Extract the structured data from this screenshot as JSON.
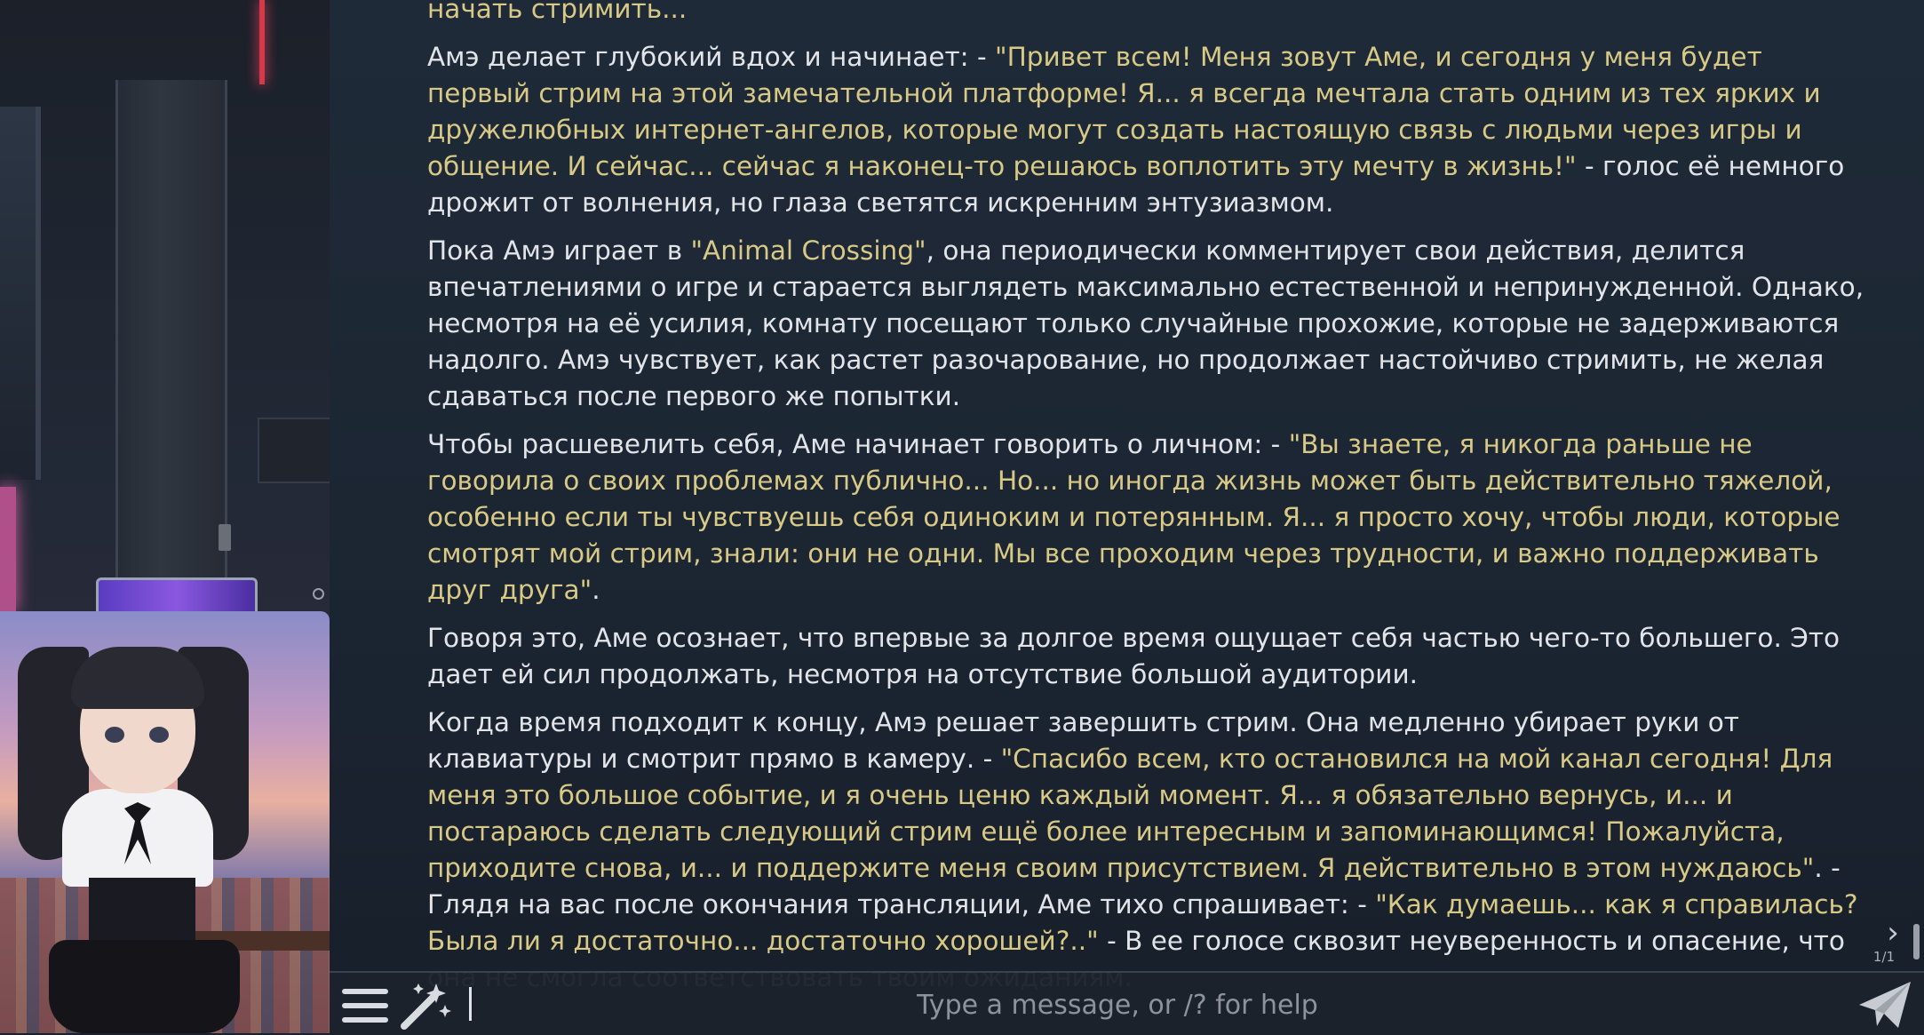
{
  "chat": {
    "top_cut_text": "начать стримить...",
    "paragraphs": [
      {
        "segments": [
          {
            "text": "Амэ делает глубокий вдох и начинает: - ",
            "quote": false
          },
          {
            "text": "\"Привет всем! Меня зовут Аме, и сегодня у меня будет первый стрим на этой замечательной платформе! Я... я всегда мечтала стать одним из тех ярких и дружелюбных интернет-ангелов, которые могут создать настоящую связь с людьми через игры и общение. И сейчас... сейчас я наконец-то решаюсь воплотить эту мечту в жизнь!\"",
            "quote": true
          },
          {
            "text": " - голос её немного дрожит от волнения, но глаза светятся искренним энтузиазмом.",
            "quote": false
          }
        ]
      },
      {
        "segments": [
          {
            "text": "Пока Амэ играет в ",
            "quote": false
          },
          {
            "text": "\"Animal Crossing\"",
            "quote": true
          },
          {
            "text": ", она периодически комментирует свои действия, делится впечатлениями о игре и старается выглядеть максимально естественной и непринужденной. Однако, несмотря на её усилия, комнату посещают только случайные прохожие, которые не задерживаются надолго. Амэ чувствует, как растет разочарование, но продолжает настойчиво стримить, не желая сдаваться после первого же попытки.",
            "quote": false
          }
        ]
      },
      {
        "segments": [
          {
            "text": "Чтобы расшевелить себя, Аме начинает говорить о личном: - ",
            "quote": false
          },
          {
            "text": "\"Вы знаете, я никогда раньше не говорила о своих проблемах публично... Но... но иногда жизнь может быть действительно тяжелой, особенно если ты чувствуешь себя одиноким и потерянным. Я... я просто хочу, чтобы люди, которые смотрят мой стрим, знали: они не одни. Мы все проходим через трудности, и важно поддерживать друг друга\"",
            "quote": true
          },
          {
            "text": ".",
            "quote": false
          }
        ]
      },
      {
        "segments": [
          {
            "text": "Говоря это, Аме осознает, что впервые за долгое время ощущает себя частью чего-то большего. Это дает ей сил продолжать, несмотря на отсутствие большой аудитории.",
            "quote": false
          }
        ]
      },
      {
        "segments": [
          {
            "text": "Когда время подходит к концу, Амэ решает завершить стрим. Она медленно убирает руки от клавиатуры и смотрит прямо в камеру. - ",
            "quote": false
          },
          {
            "text": "\"Спасибо всем, кто остановился на мой канал сегодня! Для меня это большое событие, и я очень ценю каждый момент. Я... я обязательно вернусь, и... и постараюсь сделать следующий стрим ещё более интересным и запоминающимся! Пожалуйста, приходите снова, и... и поддержите меня своим присутствием. Я действительно в этом нуждаюсь\"",
            "quote": true
          },
          {
            "text": ". - Глядя на вас после окончания трансляции, Аме тихо спрашивает: - ",
            "quote": false
          },
          {
            "text": "\"Как думаешь... как я справилась? Была ли я достаточно... достаточно хорошей?..\"",
            "quote": true
          },
          {
            "text": " - В ее голосе сквозит неуверенность и опасение, что она не смогла соответствовать твоим ожиданиям.",
            "quote": false
          }
        ]
      }
    ],
    "swipe_counter": "1/1"
  },
  "input": {
    "placeholder": "Type a message, or /? for help",
    "value": ""
  },
  "icons": {
    "menu": "hamburger-menu-icon",
    "wand": "magic-wand-icon",
    "send": "paper-plane-send-icon",
    "swipe": "chevron-right-icon"
  },
  "colors": {
    "text": "#e2e4e8",
    "quote": "#d8c986",
    "background": "#1c2633",
    "input_bar": "#1c222c"
  }
}
